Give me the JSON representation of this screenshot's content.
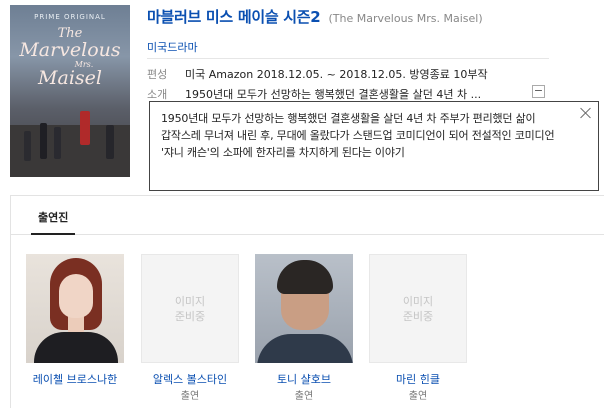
{
  "poster": {
    "label": "PRIME ORIGINAL",
    "title_line1": "The",
    "title_line2": "Marvelous",
    "title_line3": "Mrs.",
    "title_line4": "Maisel"
  },
  "header": {
    "title_ko": "마블러브 미스 메이슬 시즌2",
    "title_en": "(The Marvelous Mrs. Maisel)",
    "genre": "미국드라마"
  },
  "info": {
    "label": "편성",
    "value": "미국 Amazon 2018.12.05. ~ 2018.12.05. 방영종료 10부작"
  },
  "synopsis": {
    "label": "소개",
    "short": "1950년대 모두가 선망하는 행복했던 결혼생활을 살던 4년 차 ...",
    "more_icon": "minus-icon",
    "full": "1950년대 모두가 선망하는 행복했던 결혼생활을 살던 4년 차 주부가 편리했던 삶이 갑작스레 무너져 내린 후, 무대에 올랐다가 스탠드업 코미디언이 되어 전설적인 코미디언 '쟈니 캐슨'의 소파에 한자리를 차지하게 된다는 이야기"
  },
  "cast": {
    "tab_label": "출연진",
    "items": [
      {
        "name": "레이첼 브로스나한",
        "role": "",
        "photo": "portrait"
      },
      {
        "name": "알렉스 볼스타인",
        "role": "출연",
        "photo": "none",
        "placeholder": "이미지\n준비중"
      },
      {
        "name": "토니 샬호브",
        "role": "출연",
        "photo": "portrait"
      },
      {
        "name": "마린 힌클",
        "role": "출연",
        "photo": "none",
        "placeholder": "이미지\n준비중"
      }
    ]
  },
  "colors": {
    "link": "#0a4fb1",
    "muted": "#888888",
    "border": "#e3e3e3"
  }
}
